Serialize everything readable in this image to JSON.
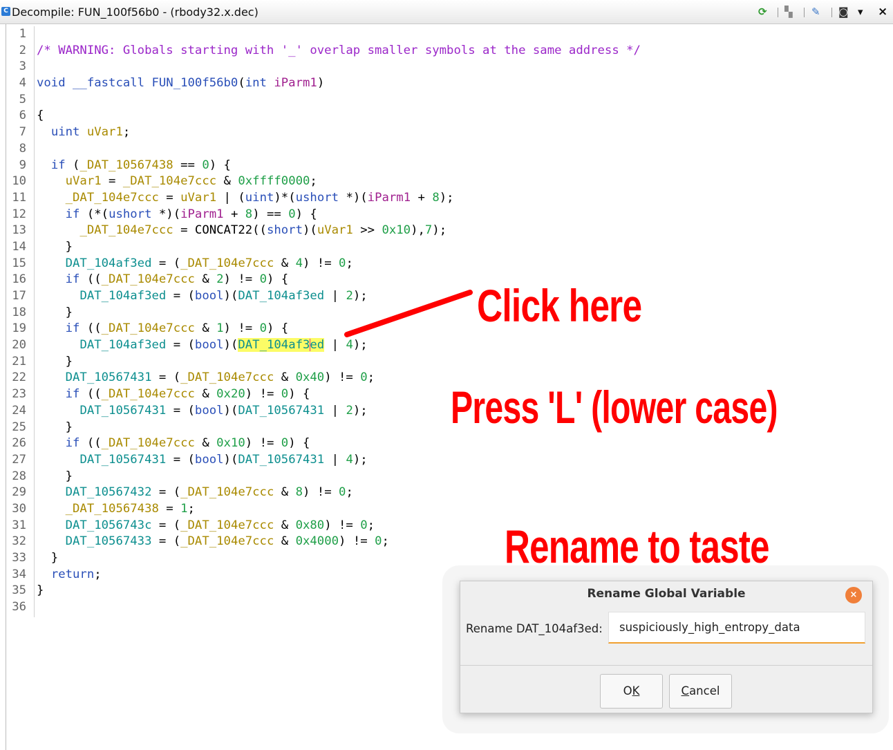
{
  "window": {
    "title": "Decompile: FUN_100f56b0 - (rbody32.x.dec)",
    "title_icon": "decompile-icon",
    "toolbar_icons": [
      "refresh-icon",
      "copy-icon",
      "edit-function-signature-icon",
      "snapshot-icon",
      "menu-dropdown-icon",
      "close-icon"
    ],
    "toolbar_glyphs": {
      "refresh": "⟳",
      "copy": "▚",
      "edit": "✎",
      "snapshot": "◙",
      "dropdown": "▾",
      "close": "×"
    }
  },
  "code": {
    "line_numbers": [
      "1",
      "2",
      "3",
      "4",
      "5",
      "6",
      "7",
      "8",
      "9",
      "10",
      "11",
      "12",
      "13",
      "14",
      "15",
      "16",
      "17",
      "18",
      "19",
      "20",
      "21",
      "22",
      "23",
      "24",
      "25",
      "26",
      "27",
      "28",
      "29",
      "30",
      "31",
      "32",
      "33",
      "34",
      "35",
      "36"
    ],
    "warning_comment": "/* WARNING: Globals starting with '_' overlap smaller symbols at the same address */",
    "signature": {
      "ret": "void",
      "conv": "__fastcall",
      "name": "FUN_100f56b0",
      "ptype": "int",
      "pname": "iParm1"
    },
    "local_type": "uint",
    "local_name": "uVar1",
    "highlighted_token": "DAT_104af3ed"
  },
  "annotations": {
    "click_here": "Click here",
    "press_l": "Press 'L' (lower case)",
    "rename": "Rename to taste",
    "arrow_color": "#ff0000"
  },
  "dialog": {
    "title": "Rename Global Variable",
    "label": "Rename DAT_104af3ed:",
    "value": "suspiciously_high_entropy_data",
    "ok_prefix": "O",
    "ok_mnemonic": "K",
    "cancel_mnemonic": "C",
    "cancel_rest": "ancel",
    "close_glyph": "×",
    "accent": "#f07f3a"
  }
}
